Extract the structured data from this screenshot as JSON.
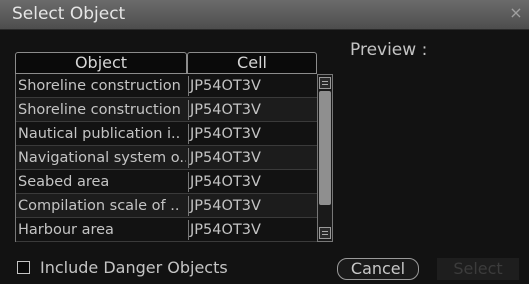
{
  "window": {
    "title": "Select Object",
    "close_glyph": "×"
  },
  "table": {
    "headers": {
      "object": "Object",
      "cell": "Cell"
    },
    "rows": [
      {
        "object": "Shoreline construction",
        "cell": "JP54OT3V"
      },
      {
        "object": "Shoreline construction",
        "cell": "JP54OT3V"
      },
      {
        "object": "Nautical publication i..",
        "cell": "JP54OT3V"
      },
      {
        "object": "Navigational system o..",
        "cell": "JP54OT3V"
      },
      {
        "object": "Seabed area",
        "cell": "JP54OT3V"
      },
      {
        "object": "Compilation scale of ..",
        "cell": "JP54OT3V"
      },
      {
        "object": "Harbour area",
        "cell": "JP54OT3V"
      }
    ]
  },
  "preview": {
    "label": "Preview :"
  },
  "footer": {
    "include_danger_label": "Include Danger Objects",
    "include_danger_checked": false,
    "cancel_label": "Cancel",
    "select_label": "Select",
    "select_enabled": false
  }
}
